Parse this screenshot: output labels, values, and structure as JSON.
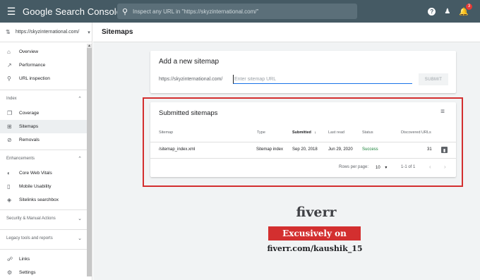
{
  "topbar": {
    "menu_icon": "hamburger-icon",
    "brand": "Google Search Console",
    "search_placeholder": "Inspect any URL in \"https://skyzinternational.com/\"",
    "notification_count": "3"
  },
  "sidebar": {
    "property": "https://skyzinternational.com/",
    "primary_items": [
      {
        "label": "Overview",
        "icon": "home-icon"
      },
      {
        "label": "Performance",
        "icon": "trend-icon"
      },
      {
        "label": "URL inspection",
        "icon": "search-icon"
      }
    ],
    "index_section": "Index",
    "index_items": [
      {
        "label": "Coverage",
        "icon": "coverage-icon"
      },
      {
        "label": "Sitemaps",
        "icon": "sitemap-icon",
        "active": true
      },
      {
        "label": "Removals",
        "icon": "removals-icon"
      }
    ],
    "enhancements_section": "Enhancements",
    "enhancement_items": [
      {
        "label": "Core Web Vitals",
        "icon": "speed-icon"
      },
      {
        "label": "Mobile Usability",
        "icon": "phone-icon"
      },
      {
        "label": "Sitelinks searchbox",
        "icon": "layers-icon"
      }
    ],
    "security_section": "Security & Manual Actions",
    "legacy_section": "Legacy tools and reports",
    "bottom_items": [
      {
        "label": "Links",
        "icon": "links-icon"
      },
      {
        "label": "Settings",
        "icon": "settings-icon"
      }
    ]
  },
  "main": {
    "page_title": "Sitemaps",
    "add_card": {
      "title": "Add a new sitemap",
      "prefix": "https://skyzinternational.com/",
      "input_placeholder": "Enter sitemap URL",
      "submit_label": "SUBMIT"
    },
    "submitted_card": {
      "title": "Submitted sitemaps",
      "columns": [
        "Sitemap",
        "Type",
        "Submitted",
        "Last read",
        "Status",
        "Discovered URLs"
      ],
      "sort_arrow": "↓",
      "rows": [
        {
          "sitemap": "/sitemap_index.xml",
          "type": "Sitemap index",
          "submitted": "Sep 20, 2018",
          "last_read": "Jun 29, 2020",
          "status": "Success",
          "discovered": "31"
        }
      ],
      "rows_per_page_label": "Rows per page:",
      "rows_per_page_value": "10",
      "range": "1-1 of 1"
    }
  },
  "watermark": {
    "logo": "fiverr",
    "banner": "Excusively on",
    "url": "fiverr.com/kaushik_15"
  },
  "colors": {
    "topbar": "#455a64",
    "highlight_box": "#d32f2f",
    "success": "#188038",
    "input_underline": "#1a73e8"
  }
}
